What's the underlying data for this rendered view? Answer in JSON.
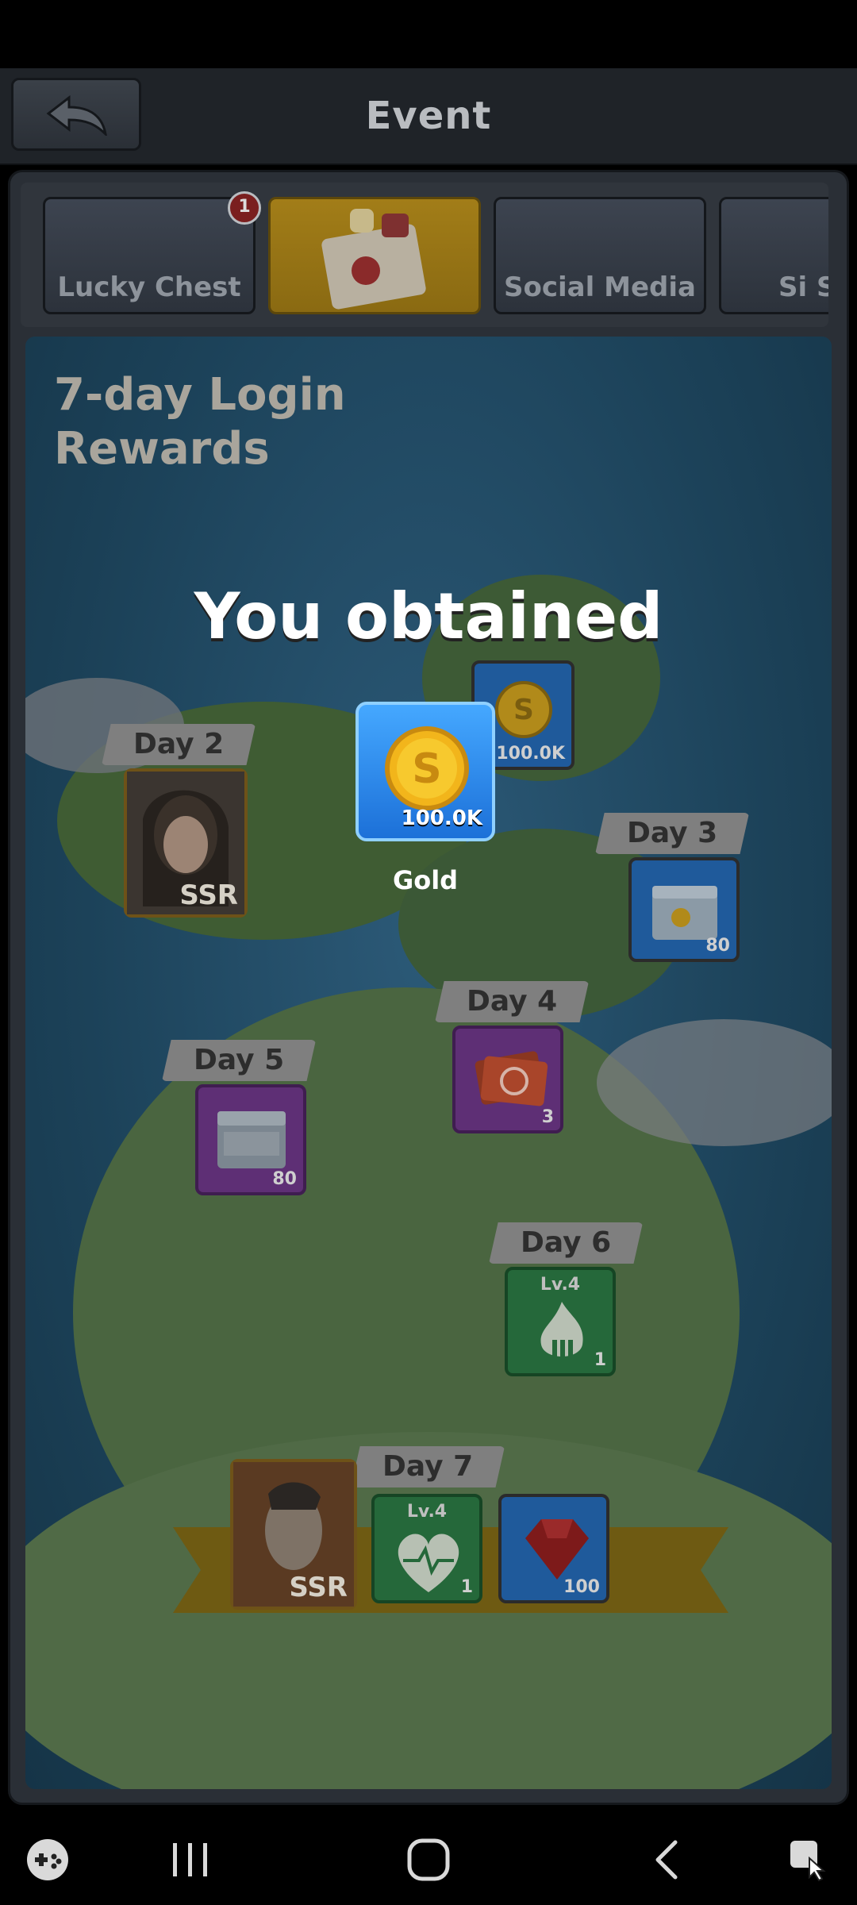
{
  "header": {
    "title": "Event"
  },
  "tabs": [
    {
      "label": "Lucky Chest",
      "badge": "1"
    },
    {
      "label": ""
    },
    {
      "label": "Social Media"
    },
    {
      "label": "Si Scra"
    }
  ],
  "panel": {
    "title_line1": "7-day Login",
    "title_line2": "Rewards"
  },
  "days": [
    {
      "label": "Day 2",
      "reward": "SSR"
    },
    {
      "label": "Day 3",
      "qty": "80"
    },
    {
      "label": "Day 4",
      "qty": "3"
    },
    {
      "label": "Day 5",
      "qty": "80"
    },
    {
      "label": "Day 6",
      "level": "Lv.4",
      "qty": "1"
    },
    {
      "label": "Day 7",
      "rewards": [
        {
          "reward": "SSR"
        },
        {
          "level": "Lv.4",
          "qty": "1"
        },
        {
          "qty": "100"
        }
      ]
    }
  ],
  "background_day1": {
    "qty": "100.0K"
  },
  "popup": {
    "title": "You obtained",
    "item_qty": "100.0K",
    "item_name": "Gold"
  },
  "colors": {
    "accent": "#f2b51b",
    "item_blue": "#2a86e8"
  }
}
